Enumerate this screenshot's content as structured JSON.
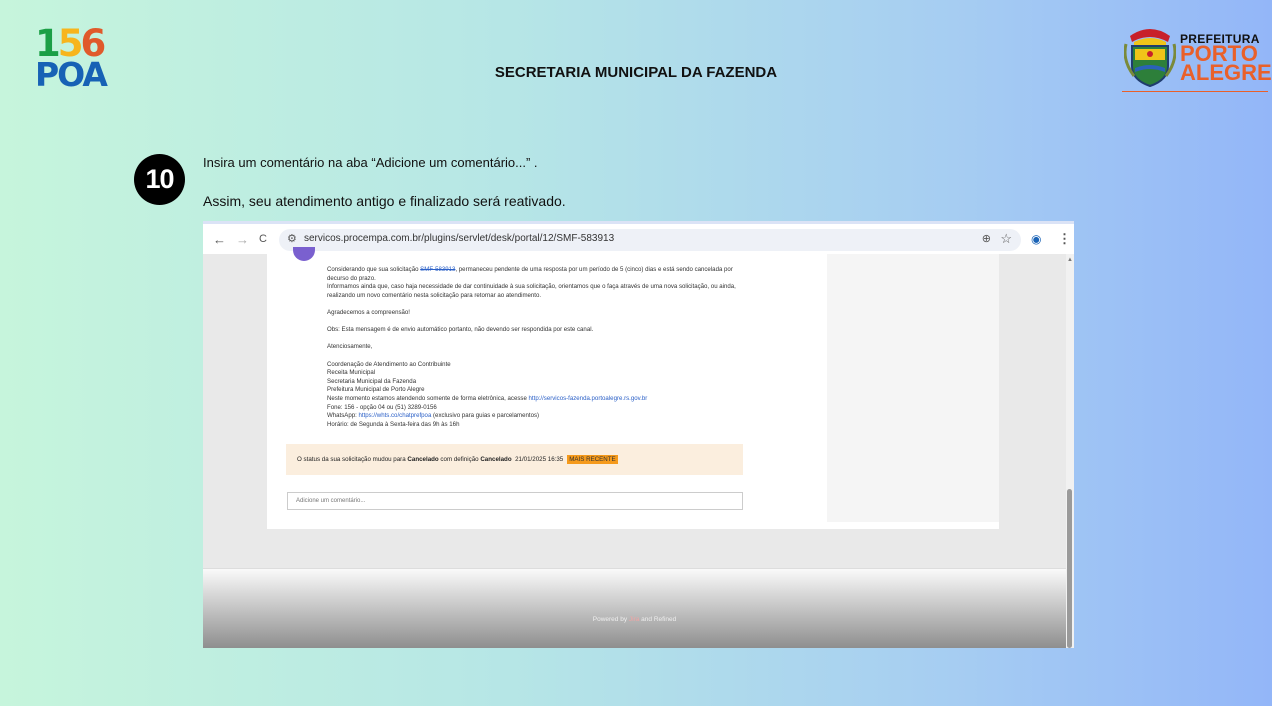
{
  "header": {
    "logo_left": {
      "digits": [
        "1",
        "5",
        "6"
      ],
      "digit_colors": [
        "#1b9f46",
        "#f7b51c",
        "#e05a2b"
      ],
      "poa": "POA"
    },
    "title": "SECRETARIA MUNICIPAL DA FAZENDA",
    "logo_right": {
      "line1": "PREFEITURA",
      "line2": "PORTO",
      "line3": "ALEGRE",
      "accent": "#e9602a"
    }
  },
  "step": {
    "number": "10",
    "instruction1": "Insira um comentário na aba “Adicione um comentário...” .",
    "instruction2": "Assim, seu atendimento antigo e finalizado será reativado."
  },
  "browser": {
    "url": "servicos.procempa.com.br/plugins/servlet/desk/portal/12/SMF-583913",
    "back": "←",
    "forward": "→",
    "reload": "C"
  },
  "message": {
    "p1_before": "Considerando que sua solicitação ",
    "ticket": "SMF-583913",
    "p1_after": ", permaneceu pendente de uma resposta por um período de 5 (cinco) dias e está sendo cancelada por decurso do prazo.",
    "p2": "Informamos ainda que, caso haja necessidade de dar continuidade à sua solicitação, orientamos que o faça através de uma nova solicitação, ou ainda, realizando um novo comentário nesta solicitação para retornar ao atendimento.",
    "p3": "Agradecemos a compreensão!",
    "p4": "Obs: Esta mensagem é de envio automático portanto, não devendo ser respondida por este canal.",
    "p5": "Atenciosamente,",
    "sig1": "Coordenação de Atendimento ao Contribuinte",
    "sig2": "Receita Municipal",
    "sig3": "Secretaria Municipal da Fazenda",
    "sig4": "Prefeitura Municipal de Porto Alegre",
    "sig5_before": "Neste momento estamos atendendo somente de forma eletrônica, acesse ",
    "sig5_link": "http://servicos-fazenda.portoalegre.rs.gov.br",
    "sig6": "Fone: 156 - opção 04 ou (51) 3289-0156",
    "sig7_before": "WhatsApp: ",
    "sig7_link": "https://whts.co/chatprefpoa",
    "sig7_after": " (exclusivo para guias e parcelamentos)",
    "sig8": "Horário: de Segunda à Sexta-feira das 9h às 16h"
  },
  "status": {
    "before": "O status da sua solicitação mudou para ",
    "state1": "Cancelado",
    "middle": " com definição ",
    "state2": "Cancelado",
    "datetime": "21/01/2025 16:35",
    "badge": "MAIS RECENTE"
  },
  "comment": {
    "placeholder": "Adicione um comentário..."
  },
  "footer": {
    "powered": "Powered by ",
    "jira": "Jira",
    "and": " and ",
    "refined": "Refined"
  }
}
